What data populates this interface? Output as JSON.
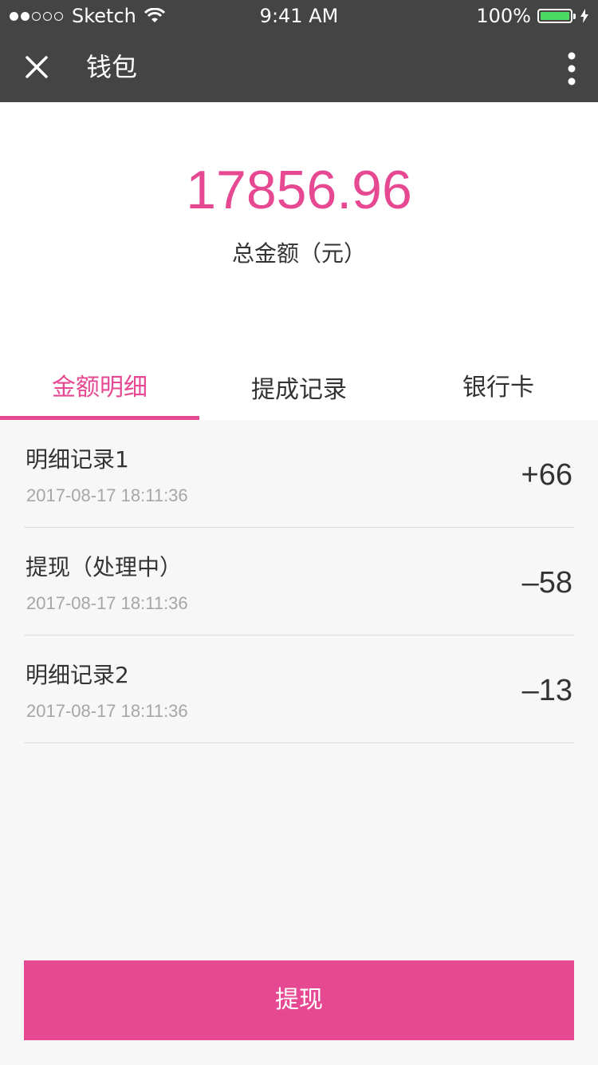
{
  "status_bar": {
    "carrier": "Sketch",
    "time": "9:41 AM",
    "battery": "100%"
  },
  "nav": {
    "title": "钱包"
  },
  "summary": {
    "amount": "17856.96",
    "label": "总金额（元）"
  },
  "tabs": [
    {
      "label": "金额明细",
      "active": true
    },
    {
      "label": "提成记录",
      "active": false
    },
    {
      "label": "银行卡",
      "active": false
    }
  ],
  "records": [
    {
      "title": "明细记录1",
      "time": "2017-08-17 18:11:36",
      "amount": "+66"
    },
    {
      "title": "提现（处理中）",
      "time": "2017-08-17 18:11:36",
      "amount": "–58"
    },
    {
      "title": "明细记录2",
      "time": "2017-08-17 18:11:36",
      "amount": "–13"
    }
  ],
  "withdraw_button": {
    "label": "提现"
  },
  "colors": {
    "accent": "#e64891",
    "nav_bg": "#444444",
    "battery": "#4cd964"
  }
}
